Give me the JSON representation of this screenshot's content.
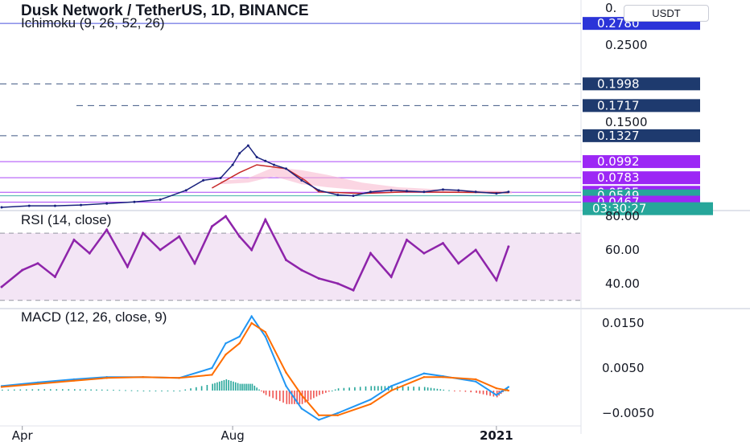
{
  "header": {
    "title": "Dusk Network / TetherUS, 1D, BINANCE",
    "subtitle": "Ichimoku (9, 26, 52, 26)",
    "currency": "USDT"
  },
  "chart_data": [
    {
      "type": "line",
      "pane": "price",
      "ylim": [
        0.04,
        0.3
      ],
      "price_ticks": [
        {
          "label": "0.",
          "value": 0.298
        },
        {
          "label": "0.2500",
          "value": 0.25
        },
        {
          "label": "0.1500",
          "value": 0.15
        }
      ],
      "price_badges": [
        {
          "label": "0.2780",
          "value": 0.278,
          "color": "#2b34d8"
        },
        {
          "label": "0.1998",
          "value": 0.1998,
          "color": "#1e3a6e"
        },
        {
          "label": "0.1717",
          "value": 0.1717,
          "color": "#1e3a6e"
        },
        {
          "label": "0.1327",
          "value": 0.1327,
          "color": "#1e3a6e"
        },
        {
          "label": "0.0992",
          "value": 0.0992,
          "color": "#9c27f5"
        },
        {
          "label": "0.0783",
          "value": 0.0783,
          "color": "#9c27f5"
        },
        {
          "label": "0.0595",
          "value": 0.0595,
          "color": "#9c27f5"
        },
        {
          "label": "0.0549",
          "value": 0.0549,
          "color": "#26a69a"
        },
        {
          "label": "0.0467",
          "value": 0.0467,
          "color": "#9c27f5"
        }
      ],
      "countdown": "03:30:27",
      "dates": [
        "2020-03-20",
        "2020-04-05",
        "2020-04-20",
        "2020-05-05",
        "2020-05-20",
        "2020-06-05",
        "2020-06-20",
        "2020-07-05",
        "2020-07-15",
        "2020-07-25",
        "2020-08-01",
        "2020-08-05",
        "2020-08-10",
        "2020-08-15",
        "2020-08-20",
        "2020-08-25",
        "2020-09-01",
        "2020-09-10",
        "2020-09-20",
        "2020-10-01",
        "2020-10-10",
        "2020-10-20",
        "2020-11-01",
        "2020-11-10",
        "2020-11-20",
        "2020-12-01",
        "2020-12-10",
        "2020-12-20",
        "2021-01-01",
        "2021-01-08"
      ],
      "series": [
        {
          "values": [
            0.04,
            0.042,
            0.042,
            0.043,
            0.045,
            0.047,
            0.05,
            0.062,
            0.075,
            0.078,
            0.095,
            0.11,
            0.12,
            0.105,
            0.1,
            0.095,
            0.09,
            0.075,
            0.062,
            0.056,
            0.055,
            0.06,
            0.062,
            0.061,
            0.06,
            0.063,
            0.062,
            0.06,
            0.058,
            0.06
          ]
        }
      ]
    },
    {
      "type": "line",
      "pane": "rsi",
      "title": "RSI (14, close)",
      "ylim": [
        27,
        82
      ],
      "ticks": [
        80,
        60,
        40
      ],
      "tick_labels": [
        "80.00",
        "60.00",
        "40.00"
      ],
      "band": [
        30,
        70
      ],
      "dates": [
        "2020-03-20",
        "2020-04-01",
        "2020-04-10",
        "2020-04-20",
        "2020-05-01",
        "2020-05-10",
        "2020-05-20",
        "2020-06-01",
        "2020-06-10",
        "2020-06-20",
        "2020-07-01",
        "2020-07-10",
        "2020-07-20",
        "2020-07-28",
        "2020-08-05",
        "2020-08-12",
        "2020-08-20",
        "2020-09-01",
        "2020-09-10",
        "2020-09-20",
        "2020-10-01",
        "2020-10-10",
        "2020-10-20",
        "2020-11-01",
        "2020-11-10",
        "2020-11-20",
        "2020-12-01",
        "2020-12-10",
        "2020-12-20",
        "2021-01-01",
        "2021-01-08"
      ],
      "series": [
        {
          "values": [
            38,
            48,
            52,
            44,
            66,
            58,
            72,
            50,
            70,
            60,
            68,
            52,
            74,
            80,
            68,
            60,
            78,
            54,
            48,
            43,
            40,
            36,
            58,
            44,
            66,
            58,
            64,
            52,
            60,
            42,
            62
          ]
        }
      ]
    },
    {
      "type": "line",
      "pane": "macd",
      "title": "MACD (12, 26, close, 9)",
      "ylim": [
        -0.0075,
        0.0175
      ],
      "ticks": [
        0.015,
        0.005,
        -0.005
      ],
      "tick_labels": [
        "0.0150",
        "0.0050",
        "−0.0050"
      ],
      "dates": [
        "2020-03-20",
        "2020-04-10",
        "2020-05-01",
        "2020-05-20",
        "2020-06-10",
        "2020-07-01",
        "2020-07-20",
        "2020-07-28",
        "2020-08-05",
        "2020-08-12",
        "2020-08-20",
        "2020-09-01",
        "2020-09-10",
        "2020-09-20",
        "2020-10-01",
        "2020-10-20",
        "2020-11-01",
        "2020-11-20",
        "2020-12-01",
        "2020-12-20",
        "2021-01-01",
        "2021-01-08"
      ],
      "series": [
        {
          "name": "",
          "color": "#2196f3",
          "values": [
            0.001,
            0.0018,
            0.0025,
            0.003,
            0.003,
            0.0028,
            0.005,
            0.0105,
            0.012,
            0.0165,
            0.012,
            0.001,
            -0.004,
            -0.0065,
            -0.005,
            -0.002,
            0.001,
            0.0038,
            0.0032,
            0.002,
            -0.001,
            0.0008
          ]
        },
        {
          "name": "",
          "color": "#ff6d00",
          "values": [
            0.0008,
            0.0015,
            0.0022,
            0.0028,
            0.003,
            0.0028,
            0.0035,
            0.008,
            0.0105,
            0.015,
            0.013,
            0.004,
            -0.001,
            -0.0055,
            -0.0055,
            -0.003,
            0.0,
            0.003,
            0.003,
            0.0025,
            0.0005,
            0.0
          ]
        }
      ]
    }
  ],
  "x_axis": {
    "ticks": [
      {
        "label": "Apr",
        "date": "2020-04-01",
        "bold": false
      },
      {
        "label": "Aug",
        "date": "2020-08-01",
        "bold": false
      },
      {
        "label": "2021",
        "date": "2021-01-01",
        "bold": true
      }
    ]
  },
  "panes": {
    "rsi_label": "RSI (14, close)",
    "macd_label": "MACD (12, 26, close, 9)"
  },
  "colors": {
    "price_line": "#1a237e",
    "baseline": "#c62828",
    "rsi_line": "#8e24aa",
    "rsi_band_fill": "#f3e5f5",
    "macd_line": "#2196f3",
    "signal_line": "#ff6d00",
    "hist_up": "#26a69a",
    "hist_down": "#ef5350",
    "cloud": "#f8bbd0",
    "cloud_green": "#a5d6a7"
  }
}
